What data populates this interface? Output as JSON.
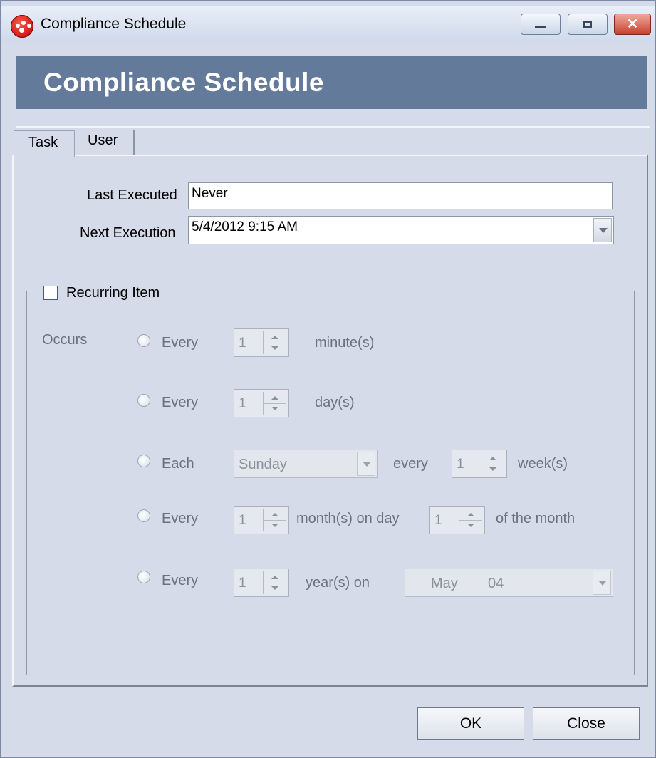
{
  "window": {
    "title": "Compliance Schedule"
  },
  "header": {
    "title": "Compliance Schedule"
  },
  "tabs": [
    {
      "label": "Task",
      "selected": true
    },
    {
      "label": "User",
      "selected": false
    }
  ],
  "task": {
    "last_executed_label": "Last Executed",
    "last_executed_value": "Never",
    "next_execution_label": "Next Execution",
    "next_execution_value": "5/4/2012 9:15 AM",
    "recurring_label": "Recurring Item",
    "recurring_checked": false,
    "occurs_label": "Occurs",
    "options": {
      "minutes": {
        "prefix": "Every",
        "value": "1",
        "unit": "minute(s)"
      },
      "days": {
        "prefix": "Every",
        "value": "1",
        "unit": "day(s)"
      },
      "weeks": {
        "prefix": "Each",
        "day": "Sunday",
        "every_label": "every",
        "value": "1",
        "unit": "week(s)"
      },
      "months": {
        "prefix": "Every",
        "value": "1",
        "unit": "month(s) on day",
        "day_value": "1",
        "suffix": "of the month"
      },
      "years": {
        "prefix": "Every",
        "value": "1",
        "unit": "year(s) on",
        "month": "May",
        "day": "04"
      }
    }
  },
  "buttons": {
    "ok": "OK",
    "close": "Close"
  },
  "icons": {
    "app": "compliance-app-icon",
    "minimize": "minimize-icon",
    "maximize": "maximize-icon",
    "close": "close-icon"
  },
  "colors": {
    "banner": "#647a9a",
    "window_bg": "#d6dbe9"
  }
}
